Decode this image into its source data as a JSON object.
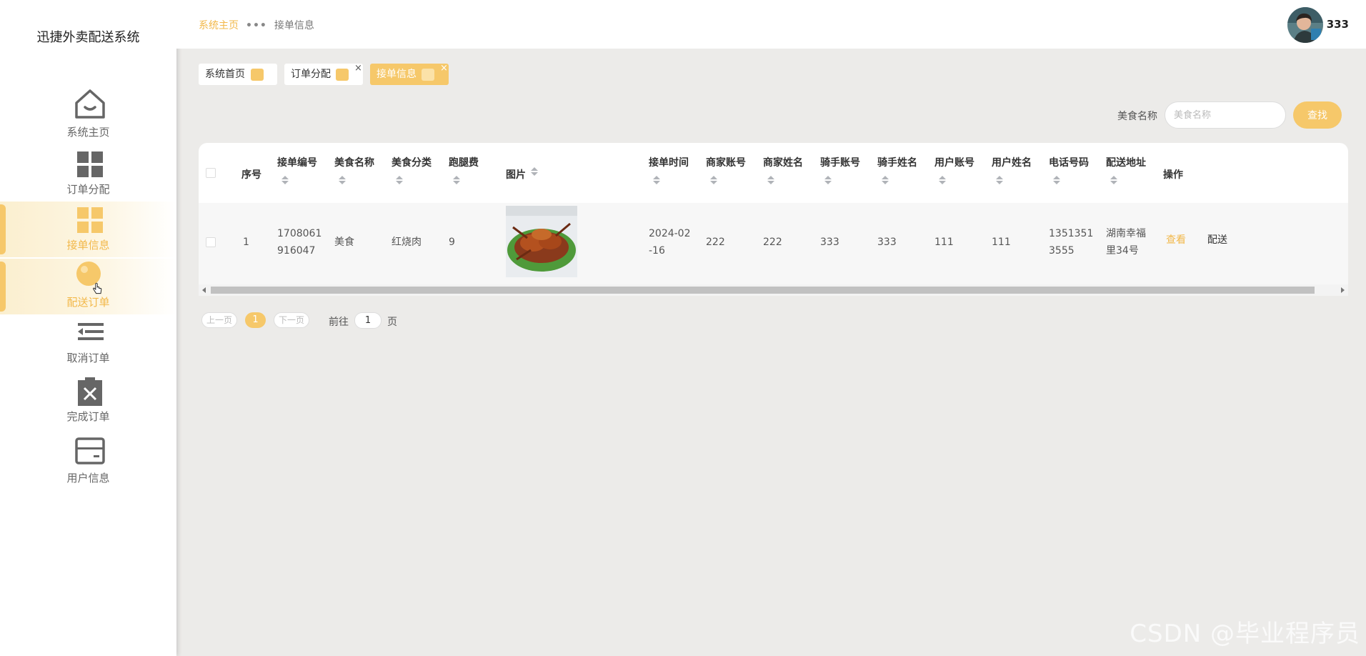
{
  "app": {
    "title": "迅捷外卖配送系统"
  },
  "sidebar": {
    "items": [
      {
        "label": "系统主页",
        "icon": "home-icon"
      },
      {
        "label": "订单分配",
        "icon": "grid-icon"
      },
      {
        "label": "接单信息",
        "icon": "grid-icon",
        "active": true
      },
      {
        "label": "配送订单",
        "icon": "bulb-icon"
      },
      {
        "label": "取消订单",
        "icon": "menu-icon"
      },
      {
        "label": "完成订单",
        "icon": "clipboard-x-icon"
      },
      {
        "label": "用户信息",
        "icon": "card-icon"
      }
    ]
  },
  "header": {
    "breadcrumb_home": "系统主页",
    "breadcrumb_sep": "•••",
    "breadcrumb_current": "接单信息",
    "username": "333"
  },
  "tabs": [
    {
      "label": "系统首页"
    },
    {
      "label": "订单分配",
      "close": "×"
    },
    {
      "label": "接单信息",
      "close": "×",
      "active": true
    }
  ],
  "search": {
    "label": "美食名称",
    "placeholder": "美食名称",
    "button": "查找"
  },
  "table": {
    "columns": [
      "序号",
      "接单编号",
      "美食名称",
      "美食分类",
      "跑腿费",
      "图片",
      "接单时间",
      "商家账号",
      "商家姓名",
      "骑手账号",
      "骑手姓名",
      "用户账号",
      "用户姓名",
      "电话号码",
      "配送地址",
      "操作"
    ],
    "rows": [
      {
        "index": "1",
        "order_no_l1": "1708061",
        "order_no_l2": "916047",
        "food_name": "美食",
        "category": "红烧肉",
        "fee": "9",
        "time_l1": "2024-02",
        "time_l2": "-16",
        "merchant_account": "222",
        "merchant_name": "222",
        "rider_account": "333",
        "rider_name": "333",
        "user_account": "111",
        "user_name": "111",
        "phone_l1": "1351351",
        "phone_l2": "3555",
        "address_l1": "湖南幸福",
        "address_l2": "里34号",
        "action_view": "查看",
        "action_deliver": "配送"
      }
    ]
  },
  "pagination": {
    "prev": "上一页",
    "current": "1",
    "next": "下一页",
    "goto": "前往",
    "goto_value": "1",
    "page_unit": "页"
  },
  "watermark": "CSDN @毕业程序员",
  "colors": {
    "accent": "#f6c86a",
    "accent_text": "#f2b84a",
    "background": "#ecebe9"
  }
}
